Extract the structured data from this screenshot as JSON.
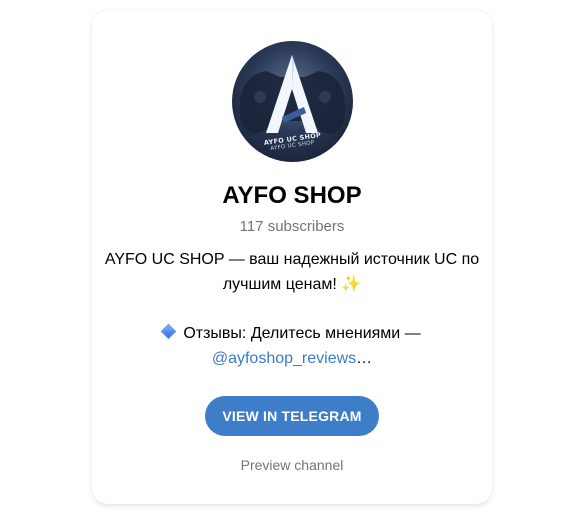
{
  "channel": {
    "avatar_text_line1": "AYFO UC SHOP",
    "avatar_text_line2": "AYFO UC SHOP",
    "title": "AYFO SHOP",
    "subscribers": "117 subscribers",
    "description_line1": "AYFO UC SHOP — ваш надежный источник UC по",
    "description_line2": "лучшим ценам! ✨",
    "reviews_text": "Отзывы: Делитесь мнениями —",
    "reviews_link": "@ayfoshop_reviews",
    "ellipsis": "…",
    "view_button": "VIEW IN TELEGRAM",
    "preview_link": "Preview channel"
  },
  "icons": {
    "avatar_logo": "ayfo-a-logo-icon",
    "reviews_marker": "blue-diamond-icon"
  },
  "colors": {
    "button_bg": "#3e7ec9",
    "link": "#3a7bc8",
    "muted": "#707579"
  }
}
